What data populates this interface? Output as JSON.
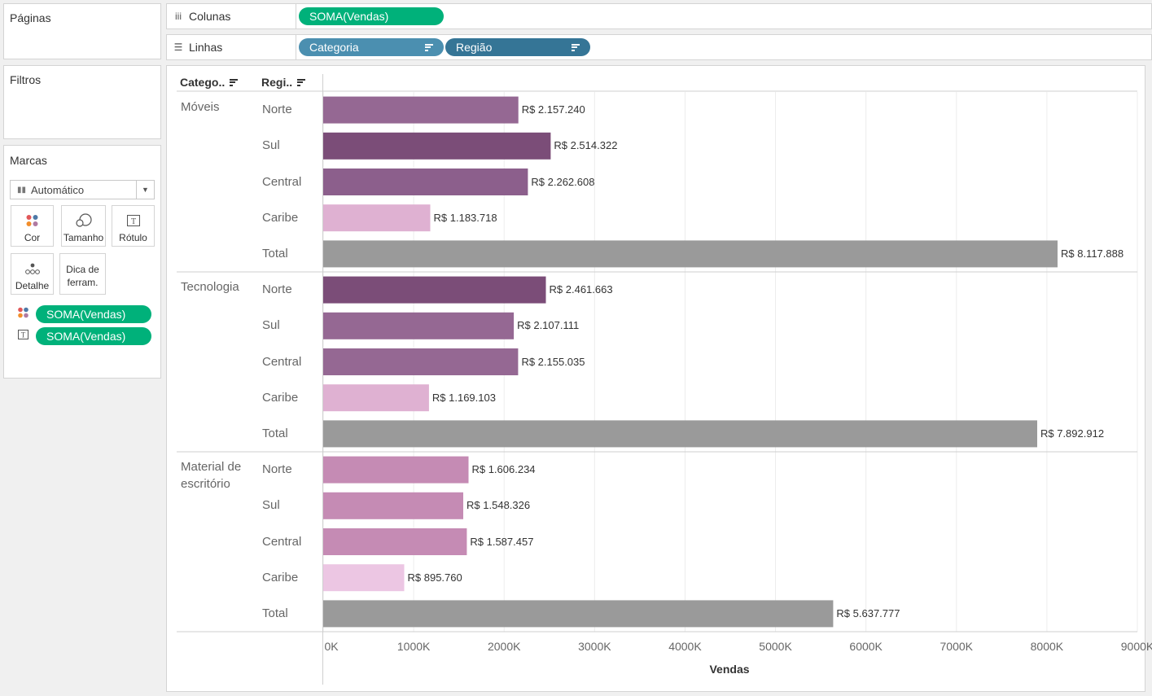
{
  "shelves": {
    "pages_title": "Páginas",
    "filters_title": "Filtros",
    "columns_label": "Colunas",
    "rows_label": "Linhas",
    "columns_pill": "SOMA(Vendas)",
    "rows_pills": [
      "Categoria",
      "Região"
    ]
  },
  "marks": {
    "title": "Marcas",
    "mark_type": "Automático",
    "buttons": {
      "color": "Cor",
      "size": "Tamanho",
      "label": "Rótulo",
      "detail": "Detalhe",
      "tooltip_line1": "Dica de",
      "tooltip_line2": "ferram."
    },
    "fields": [
      "SOMA(Vendas)",
      "SOMA(Vendas)"
    ]
  },
  "chart_data": {
    "type": "bar",
    "orientation": "horizontal",
    "xlabel": "Vendas",
    "xlim": [
      0,
      9000000
    ],
    "x_ticks": [
      "0K",
      "1000K",
      "2000K",
      "3000K",
      "4000K",
      "5000K",
      "6000K",
      "7000K",
      "8000K",
      "9000K"
    ],
    "row_headers": [
      "Catego..",
      "Regi.."
    ],
    "groups": [
      {
        "category": "Móveis",
        "bars": [
          {
            "region": "Norte",
            "value": 2157240,
            "label": "R$ 2.157.240",
            "color": "#956893"
          },
          {
            "region": "Sul",
            "value": 2514322,
            "label": "R$ 2.514.322",
            "color": "#7b4d78"
          },
          {
            "region": "Central",
            "value": 2262608,
            "label": "R$ 2.262.608",
            "color": "#8c5f8c"
          },
          {
            "region": "Caribe",
            "value": 1183718,
            "label": "R$ 1.183.718",
            "color": "#dfb1d2"
          },
          {
            "region": "Total",
            "value": 8117888,
            "label": "R$ 8.117.888",
            "color": "#9a9a9a"
          }
        ]
      },
      {
        "category": "Tecnologia",
        "bars": [
          {
            "region": "Norte",
            "value": 2461663,
            "label": "R$ 2.461.663",
            "color": "#7b4d78"
          },
          {
            "region": "Sul",
            "value": 2107111,
            "label": "R$ 2.107.111",
            "color": "#956893"
          },
          {
            "region": "Central",
            "value": 2155035,
            "label": "R$ 2.155.035",
            "color": "#956893"
          },
          {
            "region": "Caribe",
            "value": 1169103,
            "label": "R$ 1.169.103",
            "color": "#dfb1d2"
          },
          {
            "region": "Total",
            "value": 7892912,
            "label": "R$ 7.892.912",
            "color": "#9a9a9a"
          }
        ]
      },
      {
        "category": "Material de escritório",
        "category_lines": [
          "Material de",
          "escritório"
        ],
        "bars": [
          {
            "region": "Norte",
            "value": 1606234,
            "label": "R$ 1.606.234",
            "color": "#c58bb4"
          },
          {
            "region": "Sul",
            "value": 1548326,
            "label": "R$ 1.548.326",
            "color": "#c58bb4"
          },
          {
            "region": "Central",
            "value": 1587457,
            "label": "R$ 1.587.457",
            "color": "#c58bb4"
          },
          {
            "region": "Caribe",
            "value": 895760,
            "label": "R$ 895.760",
            "color": "#ecc6e3"
          },
          {
            "region": "Total",
            "value": 5637777,
            "label": "R$ 5.637.777",
            "color": "#9a9a9a"
          }
        ]
      }
    ]
  }
}
